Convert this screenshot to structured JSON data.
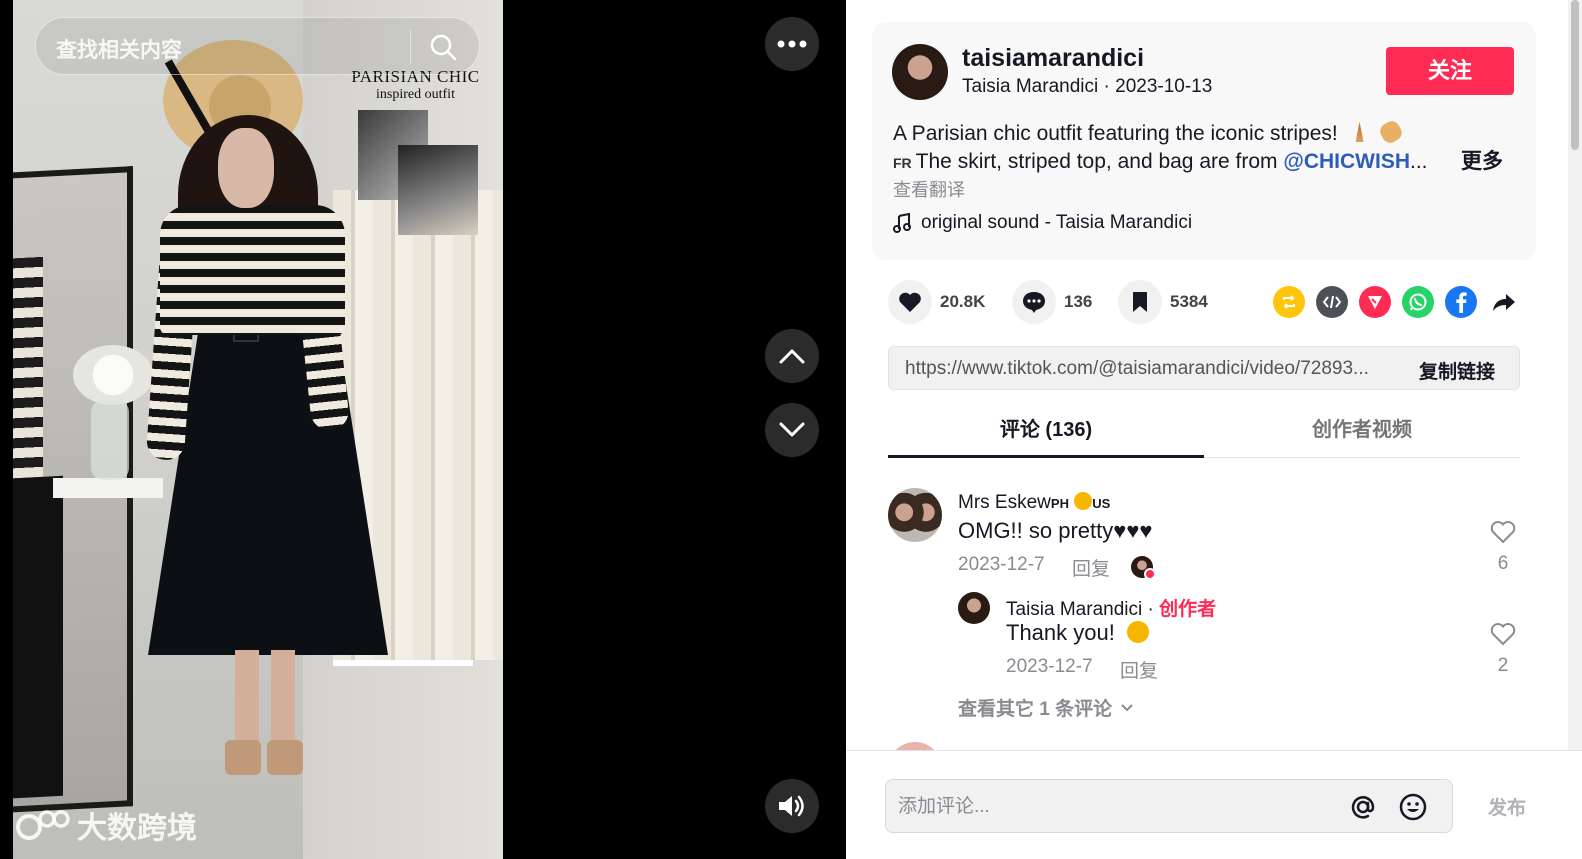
{
  "search": {
    "placeholder": "查找相关内容",
    "icon": "search-icon"
  },
  "video": {
    "overlay_title_1": "PARISIAN CHIC",
    "overlay_title_2": "inspired outfit",
    "watermark_text": "大数跨境",
    "controls": [
      "more-icon",
      "chevron-up-icon",
      "chevron-down-icon",
      "volume-icon"
    ]
  },
  "author": {
    "username": "taisiamarandici",
    "nickname": "Taisia Marandici",
    "separator": " · ",
    "date": "2023-10-13",
    "follow_label": "关注"
  },
  "description": {
    "line1": "A Parisian chic outfit featuring the iconic stripes!",
    "fr_tag": "FR",
    "line2_prefix": "The skirt, striped top, and bag are from ",
    "mention": "@CHICWISH",
    "ellipsis": "...",
    "more_label": "更多",
    "translate_label": "查看翻译"
  },
  "music": {
    "label": "original sound - Taisia Marandici",
    "icon": "music-note-icon"
  },
  "stats": {
    "likes": "20.8K",
    "comments": "136",
    "saves": "5384"
  },
  "share_icons": [
    "repost-icon",
    "embed-icon",
    "send-icon",
    "whatsapp-icon",
    "facebook-icon",
    "share-arrow-icon"
  ],
  "link": {
    "url": "https://www.tiktok.com/@taisiamarandici/video/72893...",
    "copy_label": "复制链接"
  },
  "tabs": [
    {
      "label": "评论 (136)",
      "active": true
    },
    {
      "label": "创作者视频",
      "active": false
    }
  ],
  "comments": [
    {
      "name": "Mrs Eskew",
      "badge": "PH",
      "badge2": "US",
      "text": "OMG!! so pretty",
      "hearts": "♥♥♥",
      "date": "2023-12-7",
      "reply_label": "回复",
      "likes": "6",
      "reply": {
        "name": "Taisia Marandici",
        "sep": " · ",
        "creator_label": "创作者",
        "text": "Thank you!",
        "date": "2023-12-7",
        "reply_label": "回复",
        "likes": "2"
      },
      "view_more_label": "查看其它 1 条评论"
    }
  ],
  "composer": {
    "placeholder": "添加评论...",
    "post_label": "发布"
  },
  "colors": {
    "accent": "#fe2c55",
    "mention": "#2b5db9",
    "muted": "#8a8b91"
  }
}
